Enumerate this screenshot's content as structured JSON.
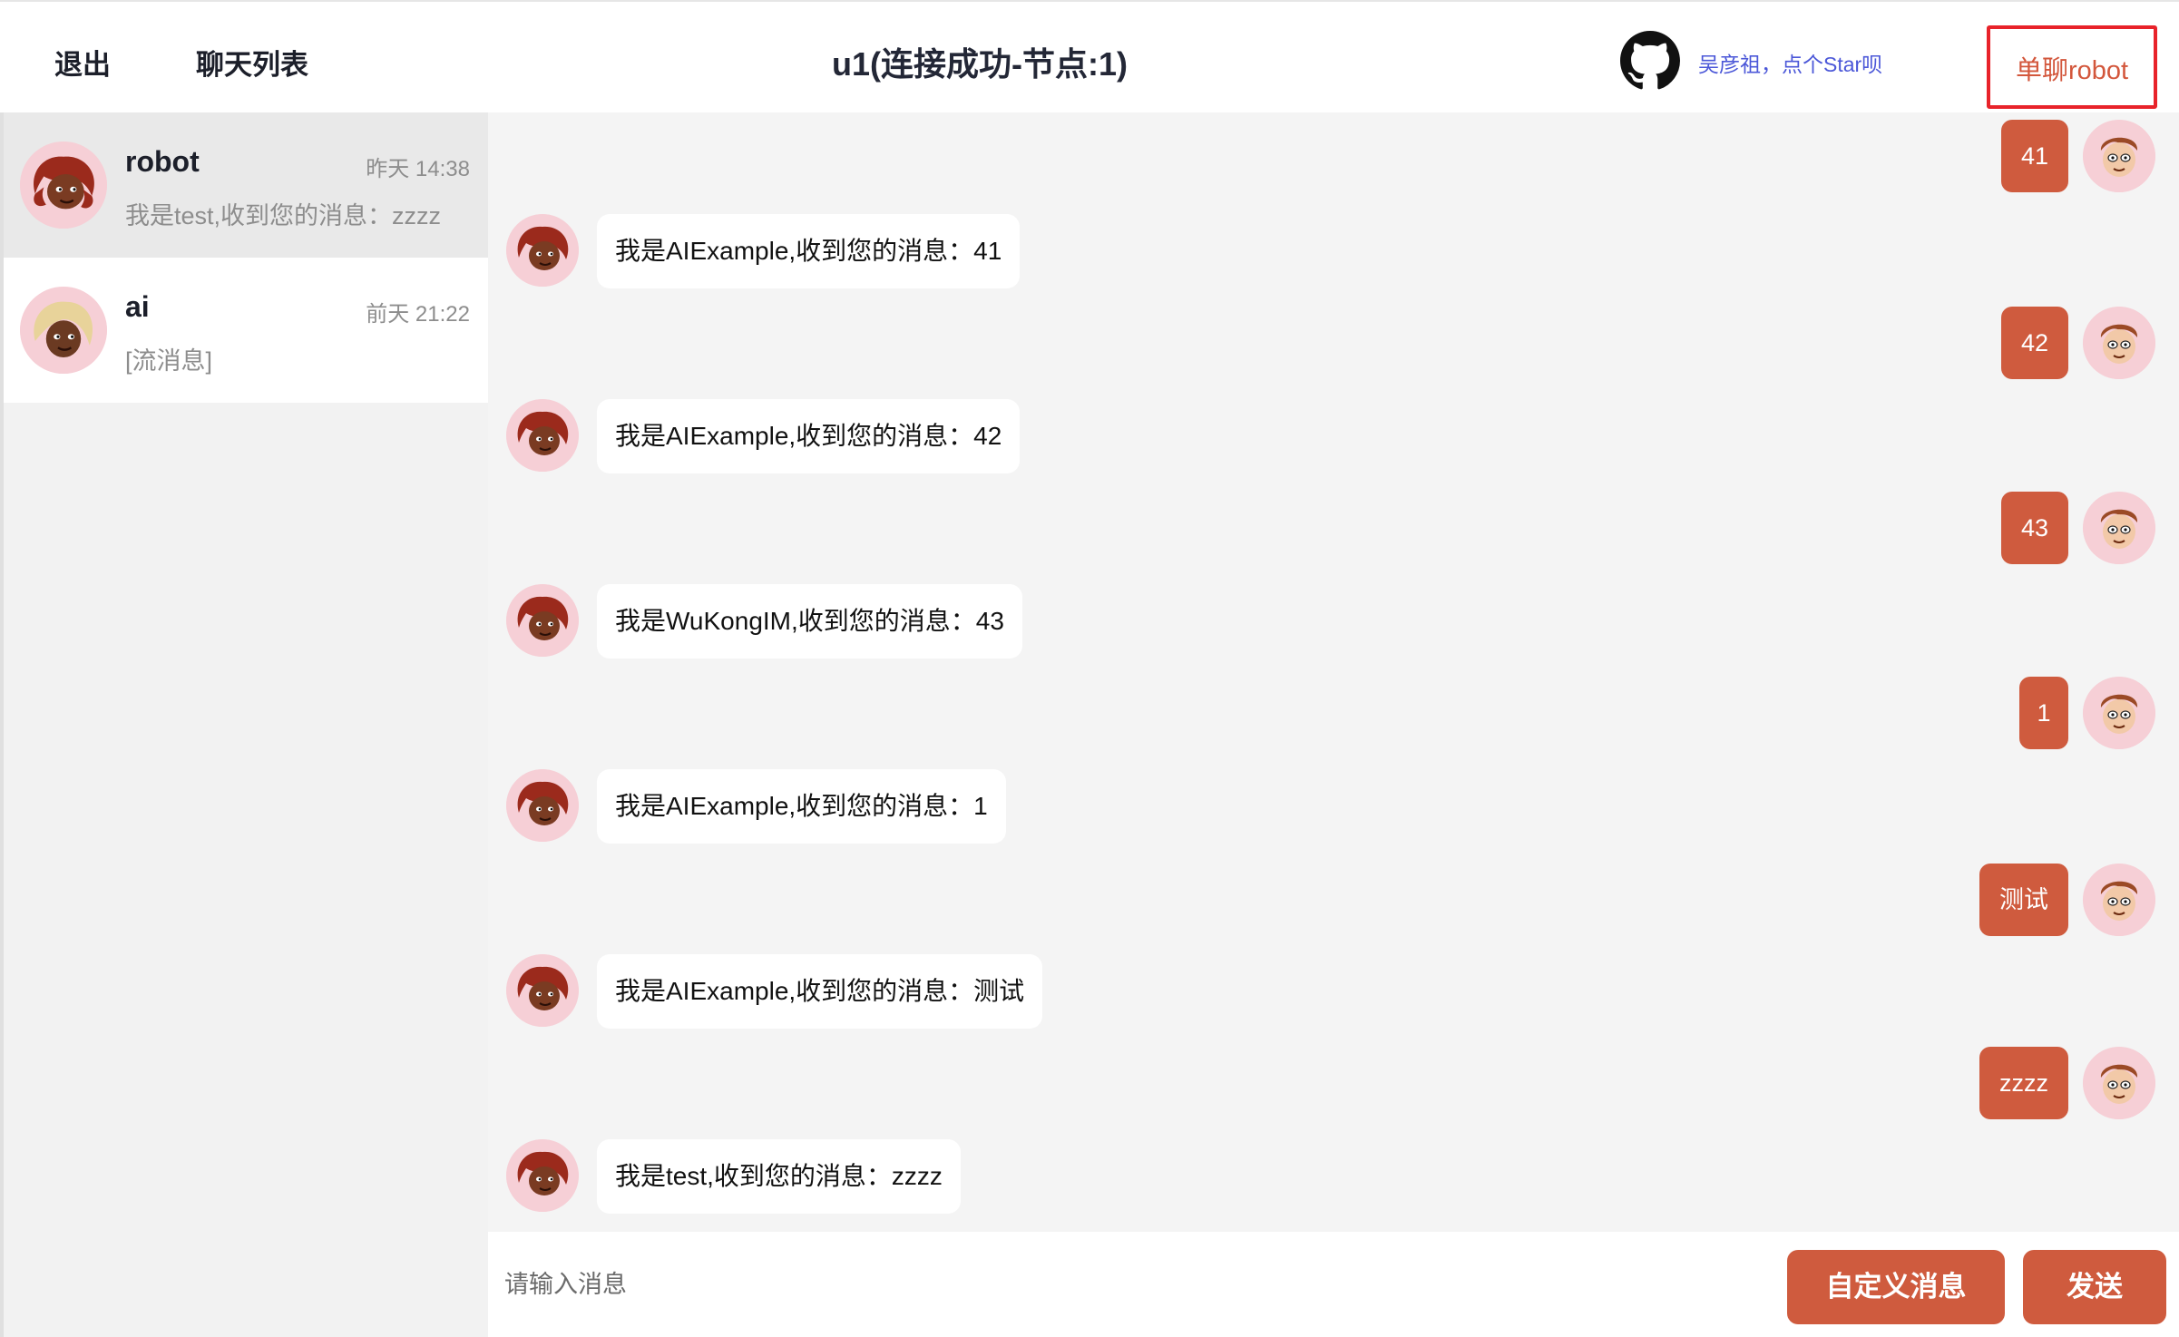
{
  "header": {
    "exit_label": "退出",
    "chat_list_label": "聊天列表",
    "title": "u1(连接成功-节点:1)",
    "github_icon": "github-icon",
    "github_text": "吴彦祖，点个Star呗",
    "single_chat_label": "单聊robot"
  },
  "conversations": [
    {
      "name": "robot",
      "time": "昨天 14:38",
      "last_message": "我是test,收到您的消息：zzzz",
      "avatar": "avatar-red-hair",
      "active": true
    },
    {
      "name": "ai",
      "time": "前天 21:22",
      "last_message": "[流消息]",
      "avatar": "avatar-blonde-hair",
      "active": false
    }
  ],
  "messages": [
    {
      "side": "right",
      "text": "41"
    },
    {
      "side": "left",
      "text": "我是AIExample,收到您的消息：41"
    },
    {
      "side": "right",
      "text": "42"
    },
    {
      "side": "left",
      "text": "我是AIExample,收到您的消息：42"
    },
    {
      "side": "right",
      "text": "43"
    },
    {
      "side": "left",
      "text": "我是WuKongIM,收到您的消息：43"
    },
    {
      "side": "right",
      "text": "1"
    },
    {
      "side": "left",
      "text": "我是AIExample,收到您的消息：1"
    },
    {
      "side": "right",
      "text": "测试"
    },
    {
      "side": "left",
      "text": "我是AIExample,收到您的消息：测试"
    },
    {
      "side": "right",
      "text": "zzzz"
    },
    {
      "side": "left",
      "text": "我是test,收到您的消息：zzzz"
    }
  ],
  "input": {
    "placeholder": "请输入消息",
    "value": ""
  },
  "buttons": {
    "custom_message": "自定义消息",
    "send": "发送"
  },
  "colors": {
    "accent": "#cf5b3e",
    "link": "#4b57d8",
    "highlight_box": "#e8232a"
  }
}
